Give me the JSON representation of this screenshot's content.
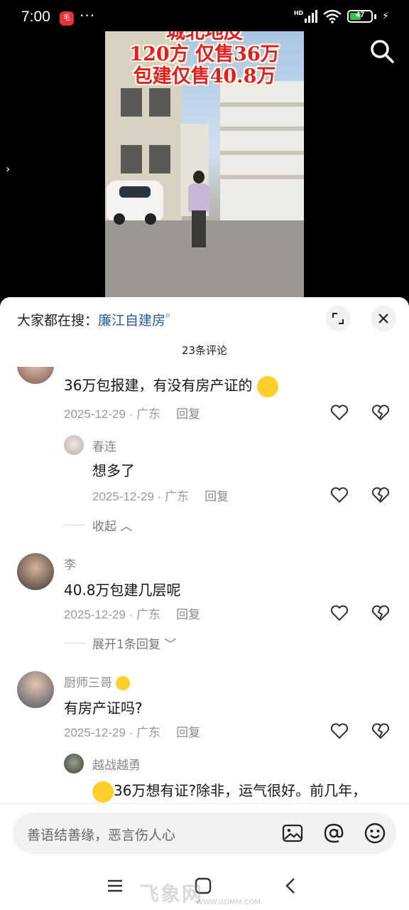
{
  "status_bar": {
    "time": "7:00",
    "app_badge": "毛",
    "dots": "···",
    "network": "HD",
    "battery": "47"
  },
  "video": {
    "caption": [
      "城北地皮",
      "120方 仅售36万",
      "包建仅售40.8万"
    ]
  },
  "sheet": {
    "search_prefix": "大家都在搜：",
    "search_keyword": "廉江自建房",
    "comment_count": "23条评论"
  },
  "comments": [
    {
      "text": "36万包报建，有没有房产证的",
      "meta": "2025-12-29 · 广东",
      "reply_label": "回复"
    },
    {
      "user": "春连",
      "text": "想多了",
      "meta": "2025-12-29 · 广东",
      "reply_label": "回复",
      "is_reply": true
    },
    {
      "collapse_label": "收起"
    },
    {
      "user": "李",
      "text": "40.8万包建几层呢",
      "meta": "2025-12-29 · 广东",
      "reply_label": "回复"
    },
    {
      "expand_label": "展开1条回复"
    },
    {
      "user": "厨师三哥",
      "text": "有房产证吗?",
      "meta": "2025-12-29 · 广东",
      "reply_label": "回复"
    },
    {
      "user": "越战越勇",
      "text": "36万想有证?除非，运气很好。前几年，",
      "is_reply": true
    }
  ],
  "input": {
    "placeholder": "善语结善缘，恶言伤人心"
  },
  "watermark": {
    "main": "飞象网",
    "sub": "WWW.GDMM.COM"
  },
  "colors": {
    "keyword": "#2e5a96",
    "battery": "#36c24f",
    "caption": "#e02020"
  }
}
